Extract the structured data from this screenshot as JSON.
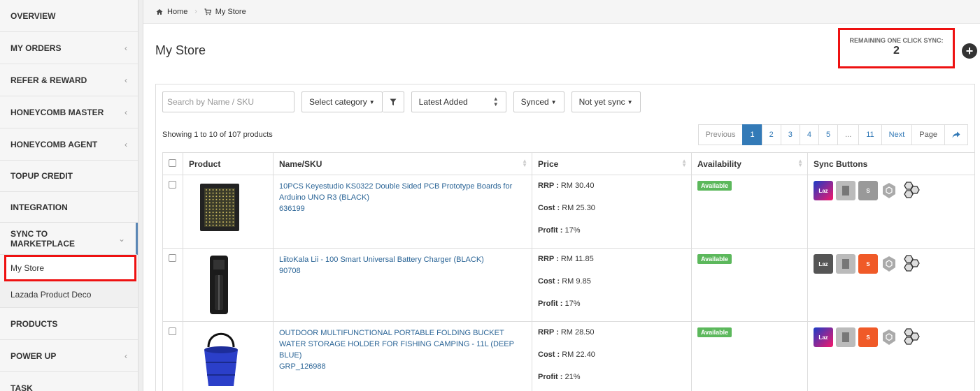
{
  "sidebar": {
    "items": [
      {
        "label": "OVERVIEW",
        "chevron": ""
      },
      {
        "label": "MY ORDERS",
        "chevron": "‹"
      },
      {
        "label": "REFER & REWARD",
        "chevron": "‹"
      },
      {
        "label": "HONEYCOMB MASTER",
        "chevron": "‹"
      },
      {
        "label": "HONEYCOMB AGENT",
        "chevron": "‹"
      },
      {
        "label": "TOPUP CREDIT",
        "chevron": ""
      },
      {
        "label": "INTEGRATION",
        "chevron": ""
      },
      {
        "label": "SYNC TO MARKETPLACE",
        "chevron": "⌄"
      }
    ],
    "subitems": [
      {
        "label": "My Store"
      },
      {
        "label": "Lazada Product Deco"
      }
    ],
    "items_after": [
      {
        "label": "PRODUCTS",
        "chevron": ""
      },
      {
        "label": "POWER UP",
        "chevron": "‹"
      },
      {
        "label": "TASK",
        "chevron": ""
      }
    ]
  },
  "breadcrumb": {
    "home": "Home",
    "current": "My Store"
  },
  "page": {
    "title": "My Store"
  },
  "sync_box": {
    "label": "REMAINING ONE CLICK SYNC:",
    "count": "2"
  },
  "toolbar": {
    "search_placeholder": "Search by Name / SKU",
    "category": "Select category",
    "sort": "Latest Added",
    "synced": "Synced",
    "not_synced": "Not yet sync"
  },
  "showing": "Showing 1 to 10 of 107 products",
  "pagination": {
    "previous": "Previous",
    "pages": [
      "1",
      "2",
      "3",
      "4",
      "5",
      "...",
      "11"
    ],
    "next": "Next",
    "page": "Page"
  },
  "table": {
    "headers": [
      "Product",
      "Name/SKU",
      "Price",
      "Availability",
      "Sync Buttons"
    ],
    "rows": [
      {
        "name": "10PCS Keyestudio KS0322 Double Sided PCB Prototype Boards for Arduino UNO R3 (BLACK)",
        "sku": "636199",
        "rrp_label": "RRP :",
        "rrp": "RM 30.40",
        "cost_label": "Cost :",
        "cost": "RM 25.30",
        "profit_label": "Profit :",
        "profit": "17%",
        "availability": "Available",
        "lazada": "active",
        "shopee": "inactive"
      },
      {
        "name": "LiitoKala Lii - 100 Smart Universal Battery Charger (BLACK)",
        "sku": "90708",
        "rrp_label": "RRP :",
        "rrp": "RM 11.85",
        "cost_label": "Cost :",
        "cost": "RM 9.85",
        "profit_label": "Profit :",
        "profit": "17%",
        "availability": "Available",
        "lazada": "inactive",
        "shopee": "active"
      },
      {
        "name": "OUTDOOR MULTIFUNCTIONAL PORTABLE FOLDING BUCKET WATER STORAGE HOLDER FOR FISHING CAMPING - 11L (DEEP BLUE)",
        "sku": "GRP_126988",
        "rrp_label": "RRP :",
        "rrp": "RM 28.50",
        "cost_label": "Cost :",
        "cost": "RM 22.40",
        "profit_label": "Profit :",
        "profit": "21%",
        "availability": "Available",
        "lazada": "active",
        "shopee": "active"
      }
    ]
  },
  "icons": {
    "laz_text": "Laz",
    "shopee_text": "S"
  },
  "colors": {
    "accent": "#337ab7",
    "highlight": "#ee1111",
    "available": "#5cb85c",
    "shopee": "#f05a28"
  }
}
